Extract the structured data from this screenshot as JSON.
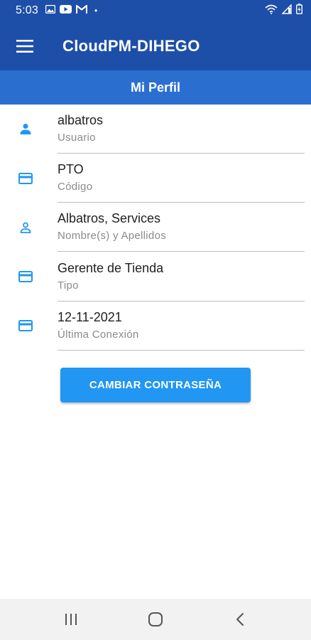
{
  "status_bar": {
    "time": "5:03",
    "dot": "•",
    "left_icons": [
      "gallery-icon",
      "youtube-icon",
      "gmail-icon"
    ],
    "right_icons": [
      "wifi-icon",
      "signal-icon",
      "battery-icon"
    ]
  },
  "app_bar": {
    "title": "CloudPM-DIHEGO",
    "menu_icon": "hamburger-menu-icon"
  },
  "sub_header": {
    "title": "Mi Perfil"
  },
  "fields": [
    {
      "value": "albatros",
      "label": "Usuario",
      "icon": "person-icon"
    },
    {
      "value": "PTO",
      "label": "Código",
      "icon": "card-icon"
    },
    {
      "value": "Albatros, Services",
      "label": "Nombre(s) y Apellidos",
      "icon": "person-outline-icon"
    },
    {
      "value": "Gerente de Tienda",
      "label": "Tipo",
      "icon": "card-icon"
    },
    {
      "value": "12-11-2021",
      "label": "Última Conexión",
      "icon": "card-icon"
    }
  ],
  "change_password_button": {
    "label": "CAMBIAR CONTRASEÑA"
  },
  "nav_bar": {
    "items": [
      "recents-icon",
      "home-icon",
      "back-icon"
    ]
  },
  "colors": {
    "app_bar": "#1e4fa8",
    "sub_header": "#2a6fd0",
    "accent": "#2196f3",
    "icon": "#2196f3"
  }
}
